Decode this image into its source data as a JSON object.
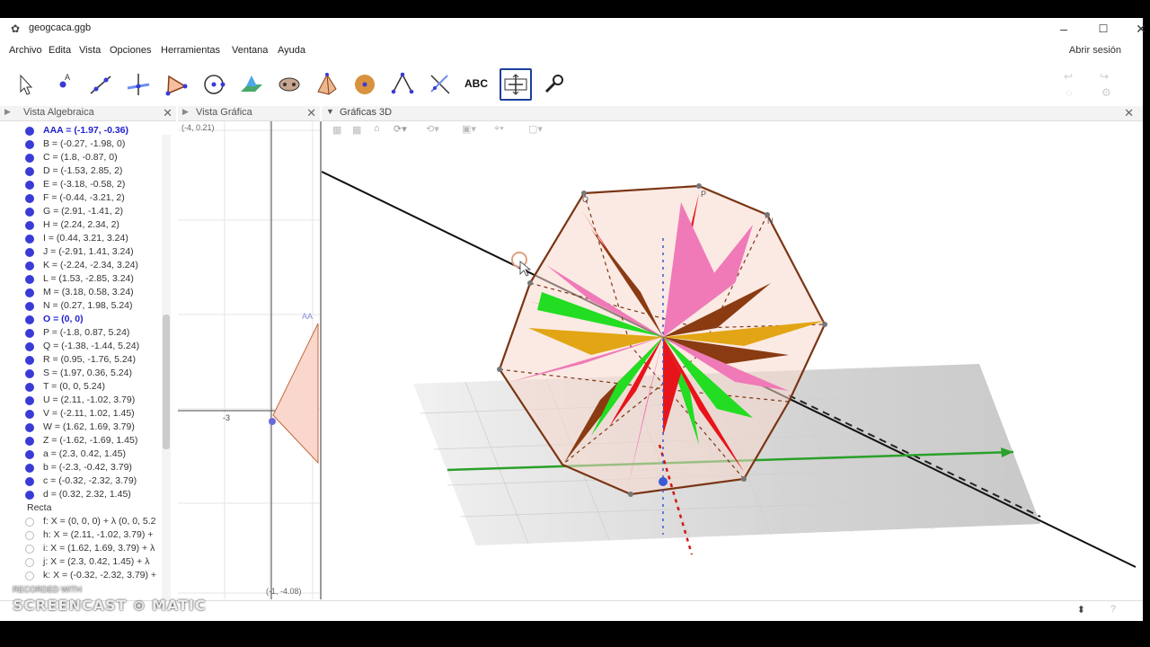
{
  "window": {
    "title": "geogcaca.ggb",
    "controls": [
      "–",
      "☐",
      "✕"
    ]
  },
  "menu": [
    "Archivo",
    "Edita",
    "Vista",
    "Opciones",
    "Herramientas",
    "Ventana",
    "Ayuda"
  ],
  "login": "Abrir sesión",
  "toolbar": {
    "tools": [
      "move-tool",
      "point-tool",
      "line-tool",
      "perpendicular-tool",
      "polygon-tool",
      "circle-tool",
      "plane-tool",
      "conic-tool",
      "pyramid-tool",
      "sphere-tool",
      "angle-tool",
      "reflect-tool",
      "text-tool",
      "rotate-view-tool",
      "settings-tool"
    ],
    "text_tool_label": "ABC",
    "selected": "rotate-view-tool"
  },
  "panels": {
    "algebra": "Vista Algebraica",
    "graphics": "Vista Gráfica",
    "graphics3d": "Gráficas 3D"
  },
  "algebra": {
    "items": [
      {
        "text": "AAA = (-1.97, -0.36)",
        "dot": true,
        "hl": true
      },
      {
        "text": "B = (-0.27, -1.98, 0)",
        "dot": true
      },
      {
        "text": "C = (1.8, -0.87, 0)",
        "dot": true
      },
      {
        "text": "D = (-1.53, 2.85, 2)",
        "dot": true
      },
      {
        "text": "E = (-3.18, -0.58, 2)",
        "dot": true
      },
      {
        "text": "F = (-0.44, -3.21, 2)",
        "dot": true
      },
      {
        "text": "G = (2.91, -1.41, 2)",
        "dot": true
      },
      {
        "text": "H = (2.24, 2.34, 2)",
        "dot": true
      },
      {
        "text": "I = (0.44, 3.21, 3.24)",
        "dot": true
      },
      {
        "text": "J = (-2.91, 1.41, 3.24)",
        "dot": true
      },
      {
        "text": "K = (-2.24, -2.34, 3.24)",
        "dot": true
      },
      {
        "text": "L = (1.53, -2.85, 3.24)",
        "dot": true
      },
      {
        "text": "M = (3.18, 0.58, 3.24)",
        "dot": true
      },
      {
        "text": "N = (0.27, 1.98, 5.24)",
        "dot": true
      },
      {
        "text": "O = (0, 0)",
        "dot": true,
        "hl": true
      },
      {
        "text": "P = (-1.8, 0.87, 5.24)",
        "dot": true
      },
      {
        "text": "Q = (-1.38, -1.44, 5.24)",
        "dot": true
      },
      {
        "text": "R = (0.95, -1.76, 5.24)",
        "dot": true
      },
      {
        "text": "S = (1.97, 0.36, 5.24)",
        "dot": true
      },
      {
        "text": "T = (0, 0, 5.24)",
        "dot": true
      },
      {
        "text": "U = (2.11, -1.02, 3.79)",
        "dot": true
      },
      {
        "text": "V = (-2.11, 1.02, 1.45)",
        "dot": true
      },
      {
        "text": "W = (1.62, 1.69, 3.79)",
        "dot": true
      },
      {
        "text": "Z = (-1.62, -1.69, 1.45)",
        "dot": true
      },
      {
        "text": "a = (2.3, 0.42, 1.45)",
        "dot": true
      },
      {
        "text": "b = (-2.3, -0.42, 3.79)",
        "dot": true
      },
      {
        "text": "c = (-0.32, -2.32, 3.79)",
        "dot": true
      },
      {
        "text": "d = (0.32, 2.32, 1.45)",
        "dot": true
      },
      {
        "text": "Recta",
        "dot": false,
        "header": true
      },
      {
        "text": "f: X = (0, 0, 0) + λ (0, 0, 5.2",
        "dot": false,
        "circle": true
      },
      {
        "text": "h: X = (2.11, -1.02, 3.79) +",
        "dot": false,
        "circle": true
      },
      {
        "text": "i: X = (1.62, 1.69, 3.79) + λ",
        "dot": false,
        "circle": true
      },
      {
        "text": "j: X = (2.3, 0.42, 1.45) + λ",
        "dot": false,
        "circle": true
      },
      {
        "text": "k: X = (-0.32, -2.32, 3.79) +",
        "dot": false,
        "circle": true
      }
    ]
  },
  "graphics": {
    "corner_top": "(-4, 0.21)",
    "corner_bottom": "(-1, -4.08)",
    "axis_tick": "-3",
    "point_label": "AA"
  },
  "view3d": {
    "point_labels": [
      "P",
      "N",
      "O"
    ],
    "colors": {
      "red": "#e8141b",
      "pink": "#f07ab8",
      "green": "#22dd22",
      "brown": "#8a3b12",
      "gold": "#e2a515"
    }
  },
  "watermark": {
    "recorded": "RECORDED WITH",
    "brand": "SCREENCAST ⊙ MATIC"
  }
}
